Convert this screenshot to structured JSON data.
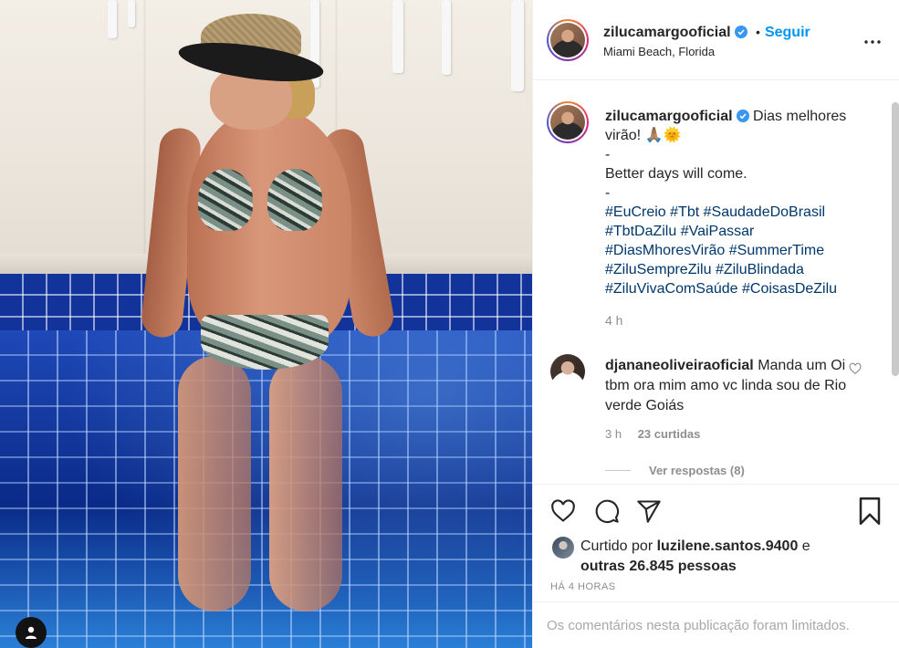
{
  "post": {
    "author": {
      "username": "zilucamargooficial",
      "verified": true,
      "follow_label": "Seguir",
      "separator": "•",
      "location": "Miami Beach, Florida"
    },
    "more_icon": "more-options-icon",
    "image": {
      "description_icon": "user-tag-icon"
    },
    "caption": {
      "username": "zilucamargooficial",
      "line1": "Dias melhores virão! 🙏🏽🌞",
      "dash1": "-",
      "line2": "Better days will come.",
      "dash2": "-",
      "hashtags": [
        "#EuCreio",
        "#Tbt",
        "#SaudadeDoBrasil",
        "#TbtDaZilu",
        "#VaiPassar",
        "#DiasMhoresVirão",
        "#SummerTime",
        "#ZiluSempreZilu",
        "#ZiluBlindada",
        "#ZiluVivaComSaúde",
        "#CoisasDeZilu"
      ],
      "time": "4 h"
    },
    "comments": [
      {
        "username": "djananeoliveiraoficial",
        "text": "Manda um Oi tbm ora mim amo vc linda sou de Rio verde Goiás",
        "time": "3 h",
        "likes": "23 curtidas",
        "view_replies": "Ver respostas (8)"
      }
    ],
    "likes": {
      "prefix": "Curtido por",
      "user": "luzilene.santos.9400",
      "connector": "e",
      "others": "outras 26.845 pessoas"
    },
    "posted_ago": "HÁ 4 HORAS",
    "comments_limited": "Os comentários nesta publicação foram limitados."
  },
  "colors": {
    "link_blue": "#0095f6",
    "hashtag": "#00376b",
    "muted": "#8e8e8e"
  }
}
